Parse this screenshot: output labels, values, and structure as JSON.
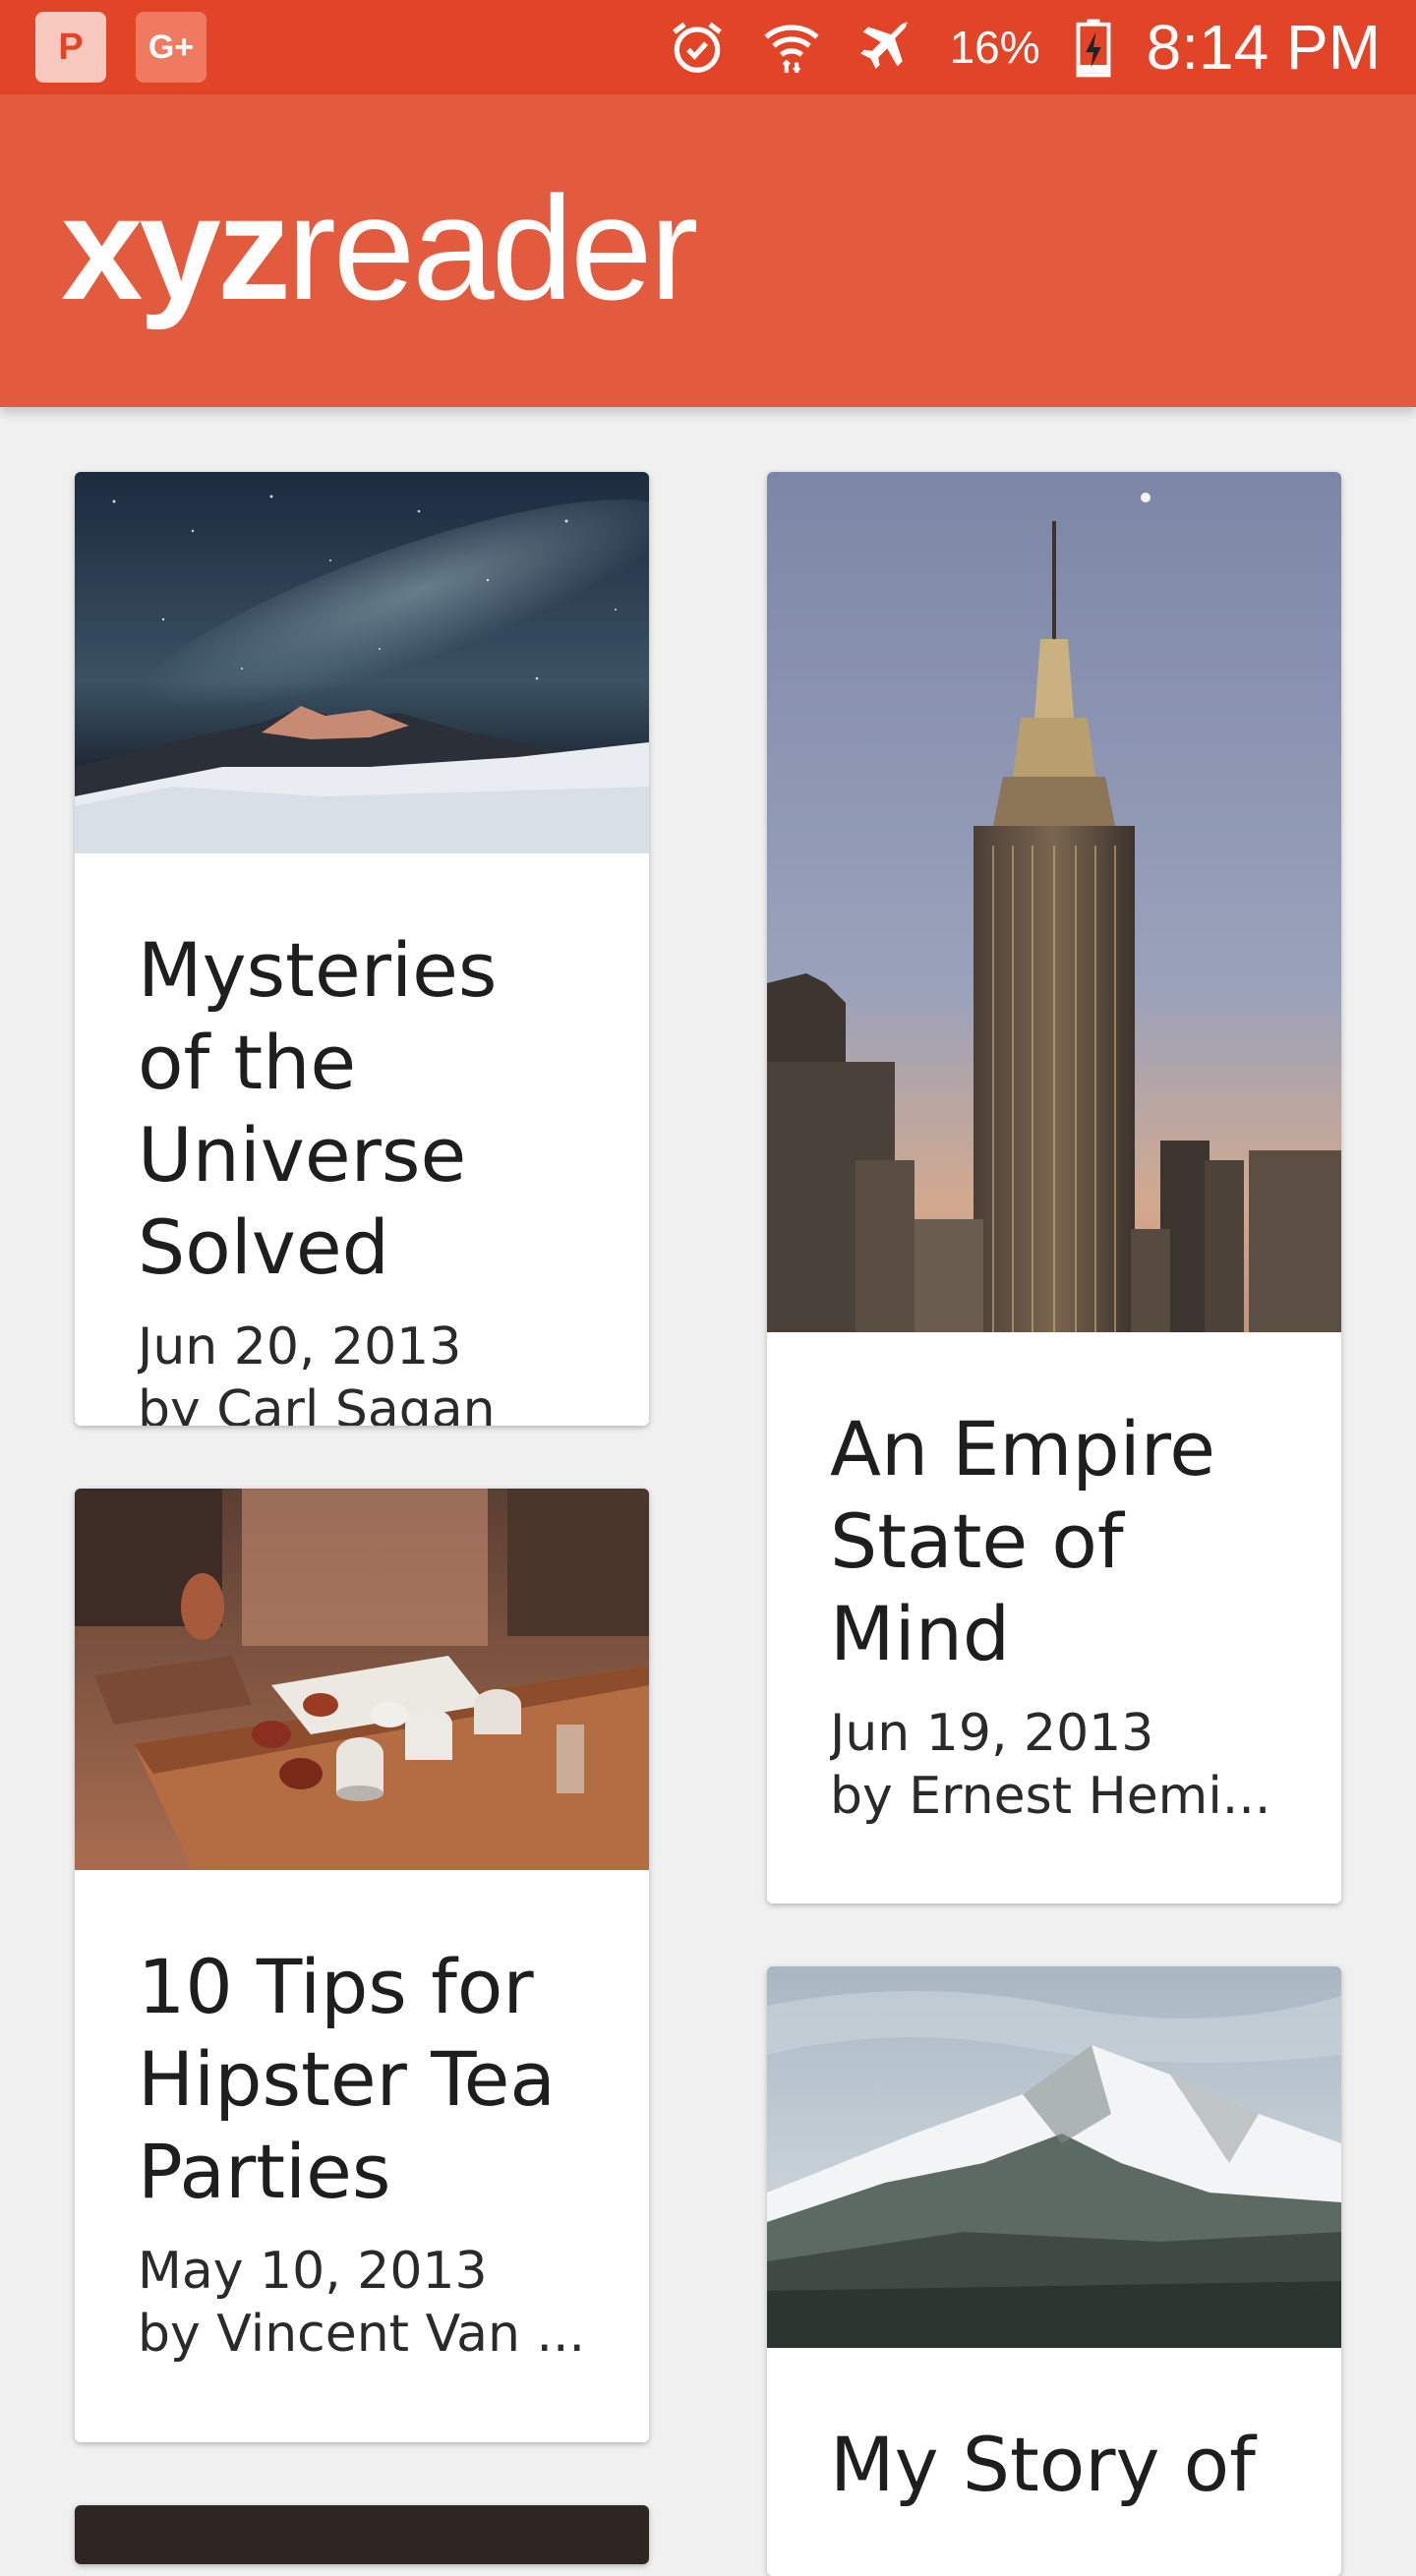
{
  "status_bar": {
    "notifications": [
      {
        "glyph": "P",
        "icon": "pocket-casts-icon"
      },
      {
        "glyph": "G+",
        "icon": "google-plus-icon"
      }
    ],
    "battery_percent": "16%",
    "time": "8:14 PM"
  },
  "app_bar": {
    "logo_bold": "xyz",
    "logo_thin": "reader"
  },
  "articles": [
    {
      "title": "Mysteries of the Universe Solved",
      "date": "Jun 20, 2013",
      "author": "by Carl Sagan",
      "image": "night-sky-mountain"
    },
    {
      "title": "An Empire State of Mind",
      "date": "Jun 19, 2013",
      "author": "by Ernest Hemi...",
      "image": "empire-state-building"
    },
    {
      "title": "10 Tips for Hipster Tea Parties",
      "date": "May 10, 2013",
      "author": "by Vincent Van ...",
      "image": "tea-cups-table"
    },
    {
      "title": "My Story of",
      "date": "",
      "author": "",
      "image": "snowy-mountain"
    },
    {
      "title": "",
      "date": "",
      "author": "",
      "image": "partial-thumbnail"
    }
  ],
  "colors": {
    "status_bar": "#e24427",
    "app_bar": "#e35b3f",
    "background": "#f0f0f0",
    "card": "#ffffff"
  }
}
